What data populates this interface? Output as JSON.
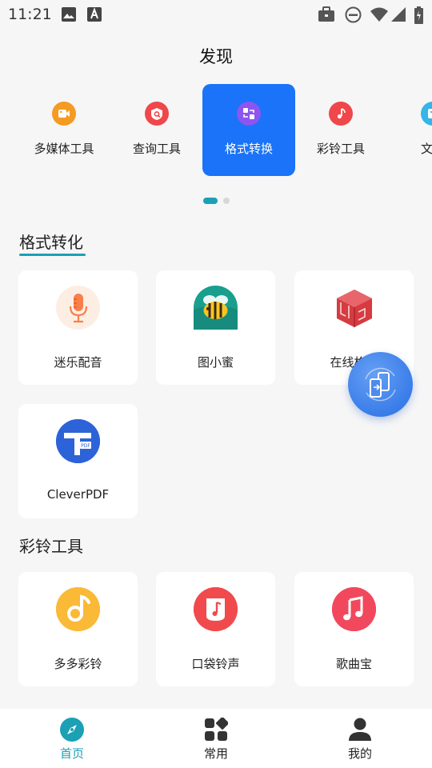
{
  "status_bar": {
    "time": "11:21",
    "icons": [
      "image-icon",
      "a-box-icon",
      "briefcase-icon",
      "do-not-disturb-icon",
      "wifi-icon",
      "signal-icon",
      "battery-icon"
    ]
  },
  "header": {
    "title": "发现"
  },
  "categories": [
    {
      "label": "多媒体工具",
      "icon": "video-icon",
      "color": "#f59a23",
      "active": false
    },
    {
      "label": "查询工具",
      "icon": "shield-search-icon",
      "color": "#f0474a",
      "active": false
    },
    {
      "label": "格式转换",
      "icon": "convert-icon",
      "color": "#8d55f0",
      "active": true
    },
    {
      "label": "彩铃工具",
      "icon": "music-note-icon",
      "color": "#f0474a",
      "active": false
    },
    {
      "label": "文字",
      "icon": "text-icon",
      "color": "#35b5e8",
      "active": false
    }
  ],
  "sections": {
    "format": {
      "title": "格式转化",
      "apps": [
        {
          "label": "迷乐配音",
          "icon": "microphone-icon"
        },
        {
          "label": "图小蜜",
          "icon": "bee-icon"
        },
        {
          "label": "在线格式",
          "icon": "cube-logo-icon"
        },
        {
          "label": "CleverPDF",
          "icon": "pdf-logo-icon"
        }
      ]
    },
    "ringtone": {
      "title": "彩铃工具",
      "apps": [
        {
          "label": "多多彩铃",
          "icon": "music-note-icon"
        },
        {
          "label": "口袋铃声",
          "icon": "pocket-music-icon"
        },
        {
          "label": "歌曲宝",
          "icon": "music-notes-icon"
        }
      ]
    }
  },
  "bottom_nav": [
    {
      "label": "首页",
      "icon": "compass-icon",
      "active": true
    },
    {
      "label": "常用",
      "icon": "grid-icon",
      "active": false
    },
    {
      "label": "我的",
      "icon": "person-icon",
      "active": false
    }
  ],
  "colors": {
    "accent": "#1ba0b4",
    "active_tab": "#1a73f8"
  }
}
